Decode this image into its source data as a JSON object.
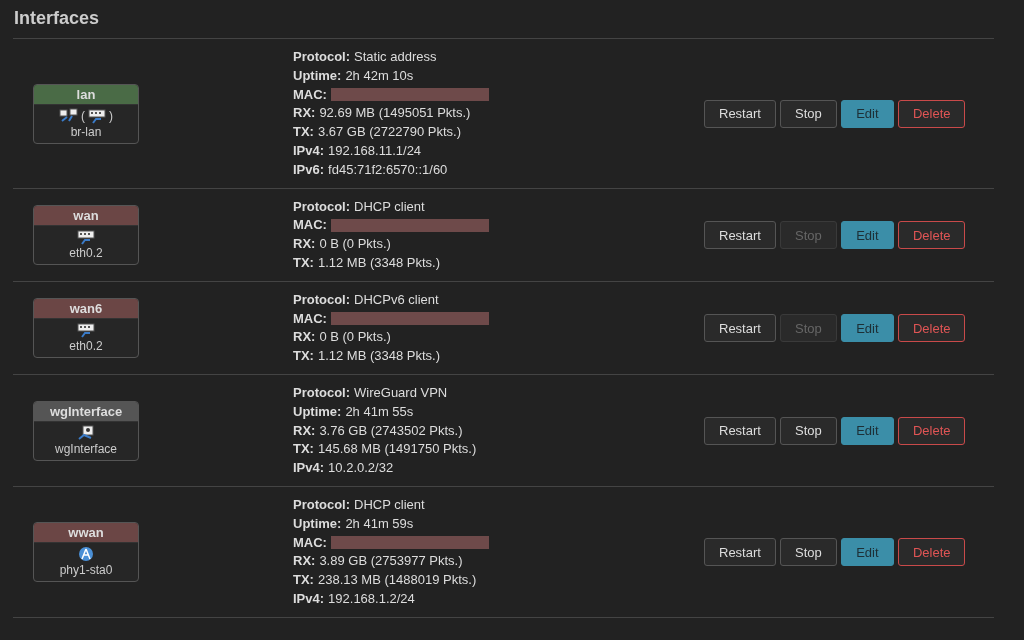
{
  "title": "Interfaces",
  "interfaces": [
    {
      "name": "lan",
      "color": "#4a6b46",
      "devices": [
        {
          "kind": "bridge"
        },
        {
          "kind": "ethernet",
          "open": "(",
          "close": ")"
        }
      ],
      "device_name": "br-lan",
      "details": [
        {
          "label": "Protocol:",
          "value": "Static address"
        },
        {
          "label": "Uptime:",
          "value": "2h 42m 10s"
        },
        {
          "label": "MAC:",
          "kind": "redacted"
        },
        {
          "label": "RX:",
          "value": "92.69 MB (1495051 Pkts.)"
        },
        {
          "label": "TX:",
          "value": "3.67 GB (2722790 Pkts.)"
        },
        {
          "label": "IPv4:",
          "value": "192.168.11.1/24"
        },
        {
          "label": "IPv6:",
          "value": "fd45:71f2:6570::1/60"
        }
      ],
      "buttons": [
        {
          "label": "Restart",
          "kind": "default",
          "disabled": false
        },
        {
          "label": "Stop",
          "kind": "default",
          "disabled": false
        },
        {
          "label": "Edit",
          "kind": "primary",
          "disabled": false
        },
        {
          "label": "Delete",
          "kind": "danger",
          "disabled": false
        }
      ]
    },
    {
      "name": "wan",
      "color": "#6b4645",
      "devices": [
        {
          "kind": "ethernet"
        }
      ],
      "device_name": "eth0.2",
      "details": [
        {
          "label": "Protocol:",
          "value": "DHCP client"
        },
        {
          "label": "MAC:",
          "kind": "redacted"
        },
        {
          "label": "RX:",
          "value": "0 B (0 Pkts.)"
        },
        {
          "label": "TX:",
          "value": "1.12 MB (3348 Pkts.)"
        }
      ],
      "buttons": [
        {
          "label": "Restart",
          "kind": "default",
          "disabled": false
        },
        {
          "label": "Stop",
          "kind": "default",
          "disabled": true
        },
        {
          "label": "Edit",
          "kind": "primary",
          "disabled": false
        },
        {
          "label": "Delete",
          "kind": "danger",
          "disabled": false
        }
      ]
    },
    {
      "name": "wan6",
      "color": "#6b4645",
      "devices": [
        {
          "kind": "ethernet"
        }
      ],
      "device_name": "eth0.2",
      "details": [
        {
          "label": "Protocol:",
          "value": "DHCPv6 client"
        },
        {
          "label": "MAC:",
          "kind": "redacted"
        },
        {
          "label": "RX:",
          "value": "0 B (0 Pkts.)"
        },
        {
          "label": "TX:",
          "value": "1.12 MB (3348 Pkts.)"
        }
      ],
      "buttons": [
        {
          "label": "Restart",
          "kind": "default",
          "disabled": false
        },
        {
          "label": "Stop",
          "kind": "default",
          "disabled": true
        },
        {
          "label": "Edit",
          "kind": "primary",
          "disabled": false
        },
        {
          "label": "Delete",
          "kind": "danger",
          "disabled": false
        }
      ]
    },
    {
      "name": "wgInterface",
      "color": "#555555",
      "devices": [
        {
          "kind": "tunnel"
        }
      ],
      "device_name": "wgInterface",
      "details": [
        {
          "label": "Protocol:",
          "value": "WireGuard VPN"
        },
        {
          "label": "Uptime:",
          "value": "2h 41m 55s"
        },
        {
          "label": "RX:",
          "value": "3.76 GB (2743502 Pkts.)"
        },
        {
          "label": "TX:",
          "value": "145.68 MB (1491750 Pkts.)"
        },
        {
          "label": "IPv4:",
          "value": "10.2.0.2/32"
        }
      ],
      "buttons": [
        {
          "label": "Restart",
          "kind": "default",
          "disabled": false
        },
        {
          "label": "Stop",
          "kind": "default",
          "disabled": false
        },
        {
          "label": "Edit",
          "kind": "primary",
          "disabled": false
        },
        {
          "label": "Delete",
          "kind": "danger",
          "disabled": false
        }
      ]
    },
    {
      "name": "wwan",
      "color": "#6b4645",
      "devices": [
        {
          "kind": "wireless"
        }
      ],
      "device_name": "phy1-sta0",
      "details": [
        {
          "label": "Protocol:",
          "value": "DHCP client"
        },
        {
          "label": "Uptime:",
          "value": "2h 41m 59s"
        },
        {
          "label": "MAC:",
          "kind": "redacted"
        },
        {
          "label": "RX:",
          "value": "3.89 GB (2753977 Pkts.)"
        },
        {
          "label": "TX:",
          "value": "238.13 MB (1488019 Pkts.)"
        },
        {
          "label": "IPv4:",
          "value": "192.168.1.2/24"
        }
      ],
      "buttons": [
        {
          "label": "Restart",
          "kind": "default",
          "disabled": false
        },
        {
          "label": "Stop",
          "kind": "default",
          "disabled": false
        },
        {
          "label": "Edit",
          "kind": "primary",
          "disabled": false
        },
        {
          "label": "Delete",
          "kind": "danger",
          "disabled": false
        }
      ]
    }
  ]
}
